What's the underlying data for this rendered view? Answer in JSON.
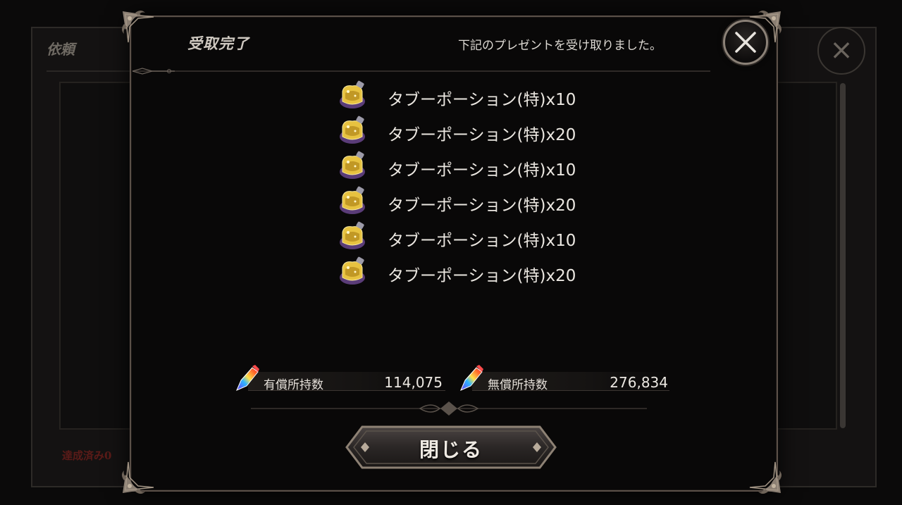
{
  "background": {
    "title": "依頼",
    "bottom_text": "達成済み0"
  },
  "dialog": {
    "title": "受取完了",
    "message": "下記のプレゼントを受け取りました。",
    "close_icon": "close-icon",
    "confirm_label": "閉じる"
  },
  "rewards": [
    {
      "label": "タブーポーション(特)x10",
      "icon": "potion-icon"
    },
    {
      "label": "タブーポーション(特)x20",
      "icon": "potion-icon"
    },
    {
      "label": "タブーポーション(特)x10",
      "icon": "potion-icon"
    },
    {
      "label": "タブーポーション(特)x20",
      "icon": "potion-icon"
    },
    {
      "label": "タブーポーション(特)x10",
      "icon": "potion-icon"
    },
    {
      "label": "タブーポーション(特)x20",
      "icon": "potion-icon"
    }
  ],
  "currency": {
    "paid": {
      "label": "有償所持数",
      "value": "114,075",
      "icon": "gem-icon"
    },
    "free": {
      "label": "無償所持数",
      "value": "276,834",
      "icon": "gem-icon"
    }
  },
  "colors": {
    "dialog_bg": "#090808",
    "frame": "#5b5048",
    "text": "#ebe7e1",
    "potion_gold": "#e8c23a",
    "potion_purple": "#6a4a8c"
  }
}
